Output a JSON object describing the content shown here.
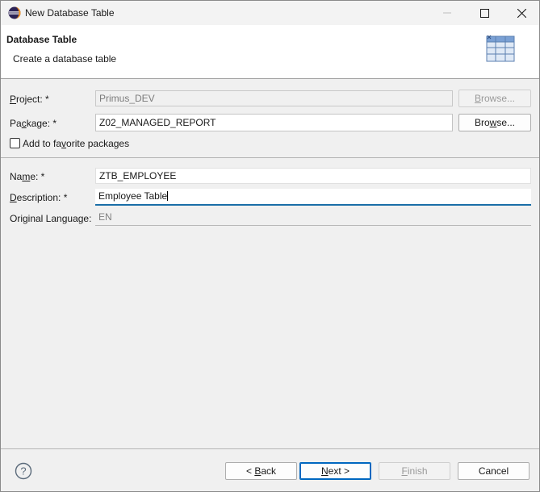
{
  "window": {
    "title": "New Database Table"
  },
  "header": {
    "title": "Database Table",
    "subtitle": "Create a database table",
    "icon": "table-wizard-icon"
  },
  "form": {
    "project": {
      "label_pre": "",
      "label_u": "P",
      "label_post": "roject: *",
      "value": "Primus_DEV",
      "browse_pre": "",
      "browse_u": "B",
      "browse_post": "rowse..."
    },
    "package": {
      "label_pre": "Pa",
      "label_u": "c",
      "label_post": "kage: *",
      "value": "Z02_MANAGED_REPORT",
      "browse_pre": "Bro",
      "browse_u": "w",
      "browse_post": "se..."
    },
    "favorite": {
      "label_pre": "Add to fa",
      "label_u": "v",
      "label_post": "orite packages",
      "checked": false
    },
    "name": {
      "label_pre": "Na",
      "label_u": "m",
      "label_post": "e: *",
      "value": "ZTB_EMPLOYEE"
    },
    "description": {
      "label_pre": "",
      "label_u": "D",
      "label_post": "escription: *",
      "value": "Employee Table"
    },
    "language": {
      "label_pre": "Original Lan",
      "label_u": "g",
      "label_post": "uage:",
      "value": "EN"
    }
  },
  "footer": {
    "back_pre": "< ",
    "back_u": "B",
    "back_post": "ack",
    "next_pre": "",
    "next_u": "N",
    "next_post": "ext >",
    "finish_pre": "",
    "finish_u": "F",
    "finish_post": "inish",
    "cancel": "Cancel"
  },
  "colors": {
    "accent": "#0067c0",
    "active_underline": "#1a6ea8",
    "header_bg": "#ffffff",
    "dialog_bg": "#f0f0f0"
  }
}
